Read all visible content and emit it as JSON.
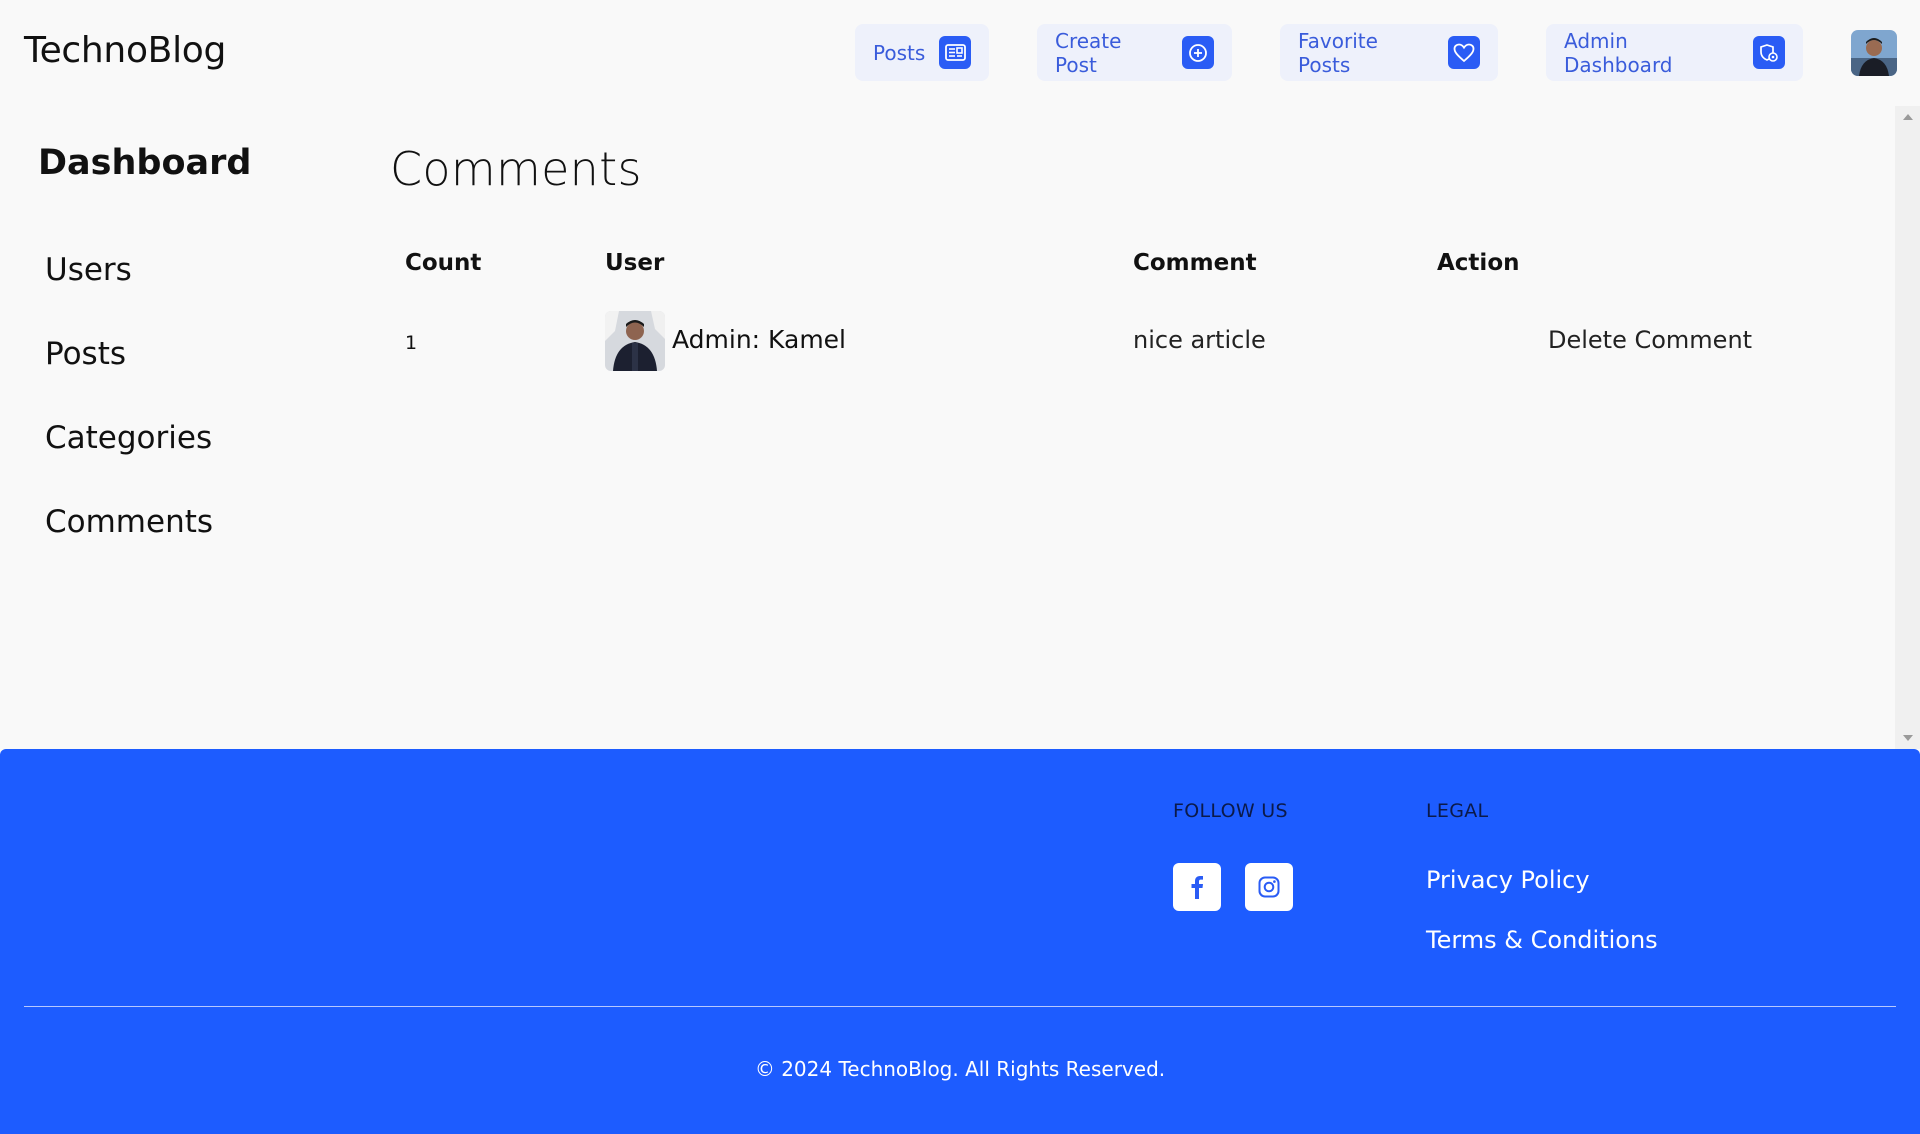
{
  "header": {
    "logo": "TechnoBlog",
    "nav": {
      "posts": "Posts",
      "create_post": "Create Post",
      "favorite_posts": "Favorite Posts",
      "admin_dashboard": "Admin Dashboard"
    }
  },
  "sidebar": {
    "title": "Dashboard",
    "items": [
      "Users",
      "Posts",
      "Categories",
      "Comments"
    ]
  },
  "main": {
    "title": "Comments",
    "table": {
      "headers": [
        "Count",
        "User",
        "Comment",
        "Action"
      ],
      "rows": [
        {
          "count": "1",
          "user": "Admin: Kamel",
          "comment": "nice article",
          "action": "Delete Comment"
        }
      ]
    }
  },
  "footer": {
    "follow_heading": "FOLLOW US",
    "legal_heading": "LEGAL",
    "links": [
      "Privacy Policy",
      "Terms & Conditions"
    ],
    "social": [
      "facebook-icon",
      "instagram-icon"
    ],
    "copyright": "© 2024 TechnoBlog. All Rights Reserved."
  },
  "colors": {
    "brand": "#1d5cff",
    "nav_bg": "#eef1fb",
    "nav_text": "#3a5cdb",
    "icon_bg": "#2a5cf5"
  }
}
